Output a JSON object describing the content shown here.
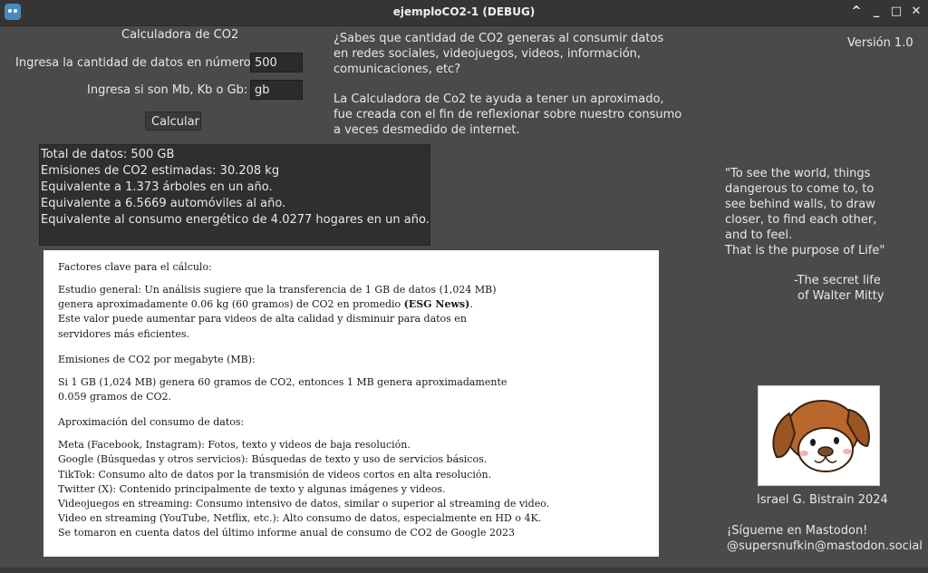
{
  "window": {
    "title": "ejemploCO2-1 (DEBUG)",
    "icon": "godot-icon",
    "controls": [
      "^",
      "_",
      "□",
      "✕"
    ]
  },
  "form": {
    "heading": "Calculadora de CO2",
    "quantity_label": "Ingresa la cantidad de datos en número:",
    "quantity_value": "500",
    "unit_label": "Ingresa si son Mb, Kb o Gb:",
    "unit_value": "gb",
    "calculate_label": "Calcular"
  },
  "intro": {
    "lines": [
      "¿Sabes que cantidad de CO2 generas al consumir datos",
      "en redes sociales, videojuegos, videos, información,",
      "comunicaciones, etc?",
      "",
      "La Calculadora de Co2 te ayuda a tener un aproximado,",
      "fue creada con el fin de reflexionar sobre nuestro consumo",
      "a veces desmedido de internet."
    ]
  },
  "version": "Versión 1.0",
  "results": [
    "Total de datos: 500 GB",
    "Emisiones de CO2 estimadas: 30.208 kg",
    "Equivalente a 1.373 árboles en un año.",
    "Equivalente a 6.5669 automóviles al año.",
    "Equivalente al consumo energético de 4.0277 hogares en un año."
  ],
  "factors": {
    "heading1": "Factores clave para el cálculo:",
    "para1_a": "Estudio general: Un análisis sugiere que la transferencia de 1 GB de datos (1,024 MB)",
    "para1_b1": "genera aproximadamente 0.06 kg (60 gramos) de CO2 en promedio ",
    "para1_b_bold": "(ESG News)",
    "para1_b2": ".",
    "para1_c": "Este valor puede aumentar para videos de alta calidad y disminuir para datos en",
    "para1_d": "servidores más eficientes.",
    "heading2": "Emisiones de CO2 por megabyte (MB):",
    "para2_a": "Si 1 GB (1,024 MB) genera 60 gramos de CO2, entonces 1 MB genera aproximadamente",
    "para2_b": "0.059 gramos de CO2.",
    "heading3": "Aproximación del consumo de datos:",
    "list": [
      "Meta (Facebook, Instagram): Fotos, texto y videos de baja resolución.",
      "Google (Búsquedas y otros servicios): Búsquedas de texto y uso de servicios básicos.",
      "TikTok: Consumo alto de datos por la transmisión de videos cortos en alta resolución.",
      "Twitter (X): Contenido principalmente de texto y algunas imágenes y videos.",
      "Videojuegos en streaming: Consumo intensivo de datos, similar o superior al streaming de video.",
      "Video en streaming (YouTube, Netflix, etc.): Alto consumo de datos, especialmente en HD o 4K.",
      "Se tomaron en cuenta datos del último informe anual de consumo de CO2 de Google 2023"
    ]
  },
  "quote": {
    "lines": [
      "\"To see the world, things",
      "dangerous to come to, to",
      "see behind walls, to draw",
      "closer, to find each other,",
      "and to feel.",
      "That is the purpose of Life\""
    ],
    "attribution_1": "-The  secret life",
    "attribution_2": "of Walter Mitty"
  },
  "author": "Israel G. Bistrain 2024",
  "social": {
    "line1": "¡Sígueme en Mastodon!",
    "line2": "@supersnufkin@mastodon.social"
  }
}
